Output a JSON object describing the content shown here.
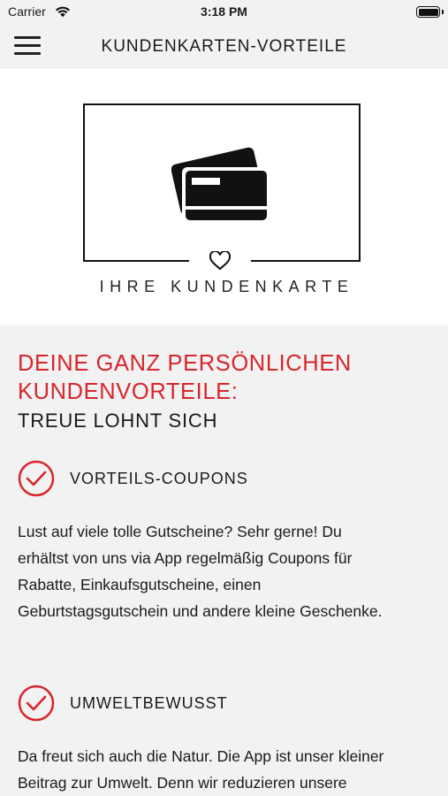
{
  "status_bar": {
    "carrier": "Carrier",
    "time": "3:18 PM"
  },
  "nav": {
    "title": "KUNDENKARTEN-VORTEILE"
  },
  "hero": {
    "caption": "IHRE KUNDENKARTE"
  },
  "content": {
    "headline_line1": "DEINE GANZ PERSÖNLICHEN",
    "headline_line2": "KUNDENVORTEILE:",
    "subline": "TREUE LOHNT SICH",
    "benefits": [
      {
        "title": "VORTEILS-COUPONS",
        "text_lines": [
          "Lust auf viele tolle Gutscheine? Sehr gerne! Du",
          "erhältst von uns via App regelmäßig Coupons für",
          "Rabatte, Einkaufsgutscheine, einen",
          "Geburtstagsgutschein und andere kleine Geschenke."
        ]
      },
      {
        "title": "UMWELTBEWUSST",
        "text_lines": [
          "Da freut sich auch die Natur. Die App ist unser kleiner",
          "Beitrag zur Umwelt. Denn wir reduzieren unsere"
        ]
      }
    ]
  },
  "colors": {
    "accent": "#d7262d",
    "background": "#f2f2f2",
    "hero_background": "#ffffff"
  },
  "icons": [
    "wifi-icon",
    "battery-icon",
    "menu-icon",
    "credit-cards-icon",
    "heart-icon",
    "check-circle-icon"
  ]
}
